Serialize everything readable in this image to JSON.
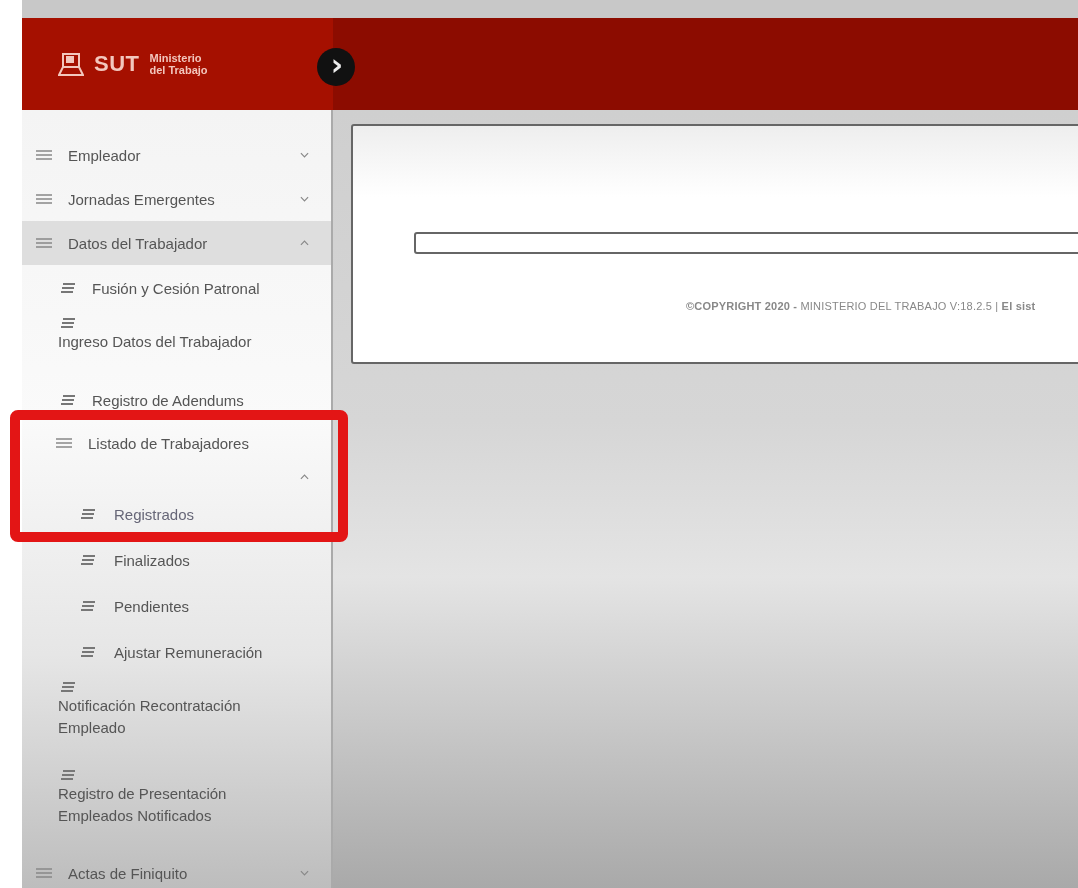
{
  "header": {
    "logo_text": "SUT",
    "ministry": "Ministerio del Trabajo",
    "toggle": "›"
  },
  "menu": [
    {
      "label": "Empleador",
      "expanded": false
    },
    {
      "label": "Jornadas Emergentes",
      "expanded": false
    },
    {
      "label": "Datos del Trabajador",
      "expanded": true,
      "children": [
        {
          "label": "Fusión y Cesión Patronal",
          "kind": "inline"
        },
        {
          "label": "Ingreso Datos del Trabajador",
          "kind": "wrapped"
        },
        {
          "label": "Registro de Adendums",
          "kind": "inline"
        },
        {
          "label": "Listado de Trabajadores",
          "kind": "group",
          "expanded": true,
          "highlighted": true,
          "children": [
            {
              "label": "Registrados",
              "highlighted": true
            },
            {
              "label": "Finalizados",
              "highlighted": false
            },
            {
              "label": "Pendientes",
              "highlighted": false
            },
            {
              "label": "Ajustar Remuneración",
              "highlighted": false
            }
          ]
        },
        {
          "label": "Notificación Recontratación Empleado",
          "kind": "wrapped"
        },
        {
          "label": "Registro de Presentación Empleados Notificados",
          "kind": "wrapped"
        }
      ]
    },
    {
      "label": "Actas de Finiquito",
      "expanded": false
    }
  ],
  "footer": {
    "copyright": "**©COPYRIGHT 2020 -** MINISTERIO DEL TRABAJO V:18.2.5 | **El sist**"
  }
}
